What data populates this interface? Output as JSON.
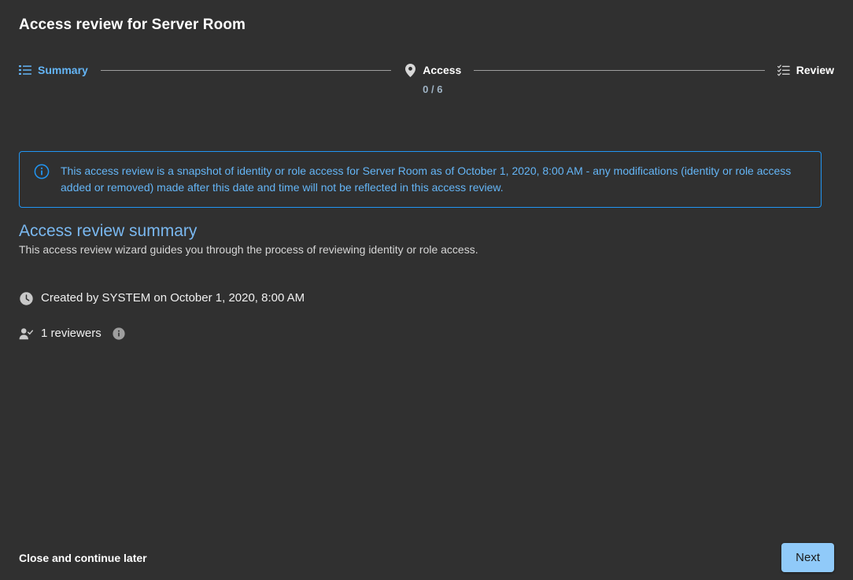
{
  "page": {
    "title": "Access review for Server Room"
  },
  "stepper": {
    "steps": [
      {
        "label": "Summary",
        "icon": "list-icon",
        "sub": "",
        "state": "active"
      },
      {
        "label": "Access",
        "icon": "location-pin-icon",
        "sub": "0 / 6",
        "state": "default"
      },
      {
        "label": "Review",
        "icon": "checklist-icon",
        "sub": "",
        "state": "default"
      }
    ]
  },
  "banner": {
    "icon": "info-circle-icon",
    "text": "This access review is a snapshot of identity or role access for Server Room as of October 1, 2020, 8:00 AM - any modifications (identity or role access added or removed) made after this date and time will not be reflected in this access review."
  },
  "summary": {
    "title": "Access review summary",
    "description": "This access review wizard guides you through the process of reviewing identity or role access.",
    "created": {
      "icon": "clock-icon",
      "text": "Created by SYSTEM on October 1, 2020, 8:00 AM"
    },
    "reviewers": {
      "icon": "person-check-icon",
      "text": "1 reviewers",
      "help_icon": "info-filled-icon"
    }
  },
  "footer": {
    "close_label": "Close and continue later",
    "next_label": "Next"
  },
  "colors": {
    "background": "#303030",
    "accent_blue": "#64b5f6",
    "banner_border": "#2196f3",
    "section_title": "#7ab8f0",
    "button_primary": "#90caf9",
    "connector": "#9e9e9e"
  }
}
